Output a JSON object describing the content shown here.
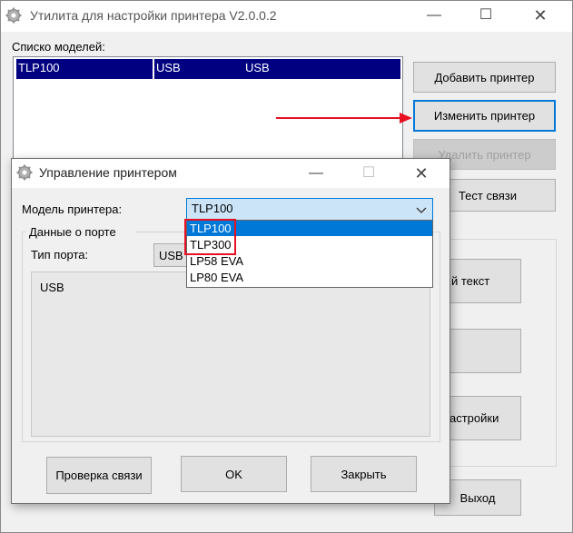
{
  "main_window": {
    "title": "Утилита для настройки принтера  V2.0.0.2",
    "models_label": "Списко моделей:",
    "model_row": {
      "name": "TLP100",
      "port": "USB",
      "type": "USB"
    },
    "buttons": {
      "add": "Добавить принтер",
      "edit": "Изменить принтер",
      "delete": "Удалить принтер",
      "test": "Тест связи",
      "text": "й текст",
      "settings": "астройки",
      "exit": "Выход"
    }
  },
  "dialog": {
    "title": "Управление принтером",
    "model_label": "Модель принтера:",
    "model_value": "TLP100",
    "options": [
      "TLP100",
      "TLP300",
      "LP58 EVA",
      "LP80 EVA"
    ],
    "group_label": "Данные о порте",
    "port_type_label": "Тип порта:",
    "port_type_value": "USB",
    "port_detail": "USB",
    "buttons": {
      "check": "Проверка связи",
      "ok": "OK",
      "close": "Закрыть"
    }
  },
  "colors": {
    "selection": "#000080",
    "highlight": "#0078d7",
    "annotation": "#e81123"
  }
}
